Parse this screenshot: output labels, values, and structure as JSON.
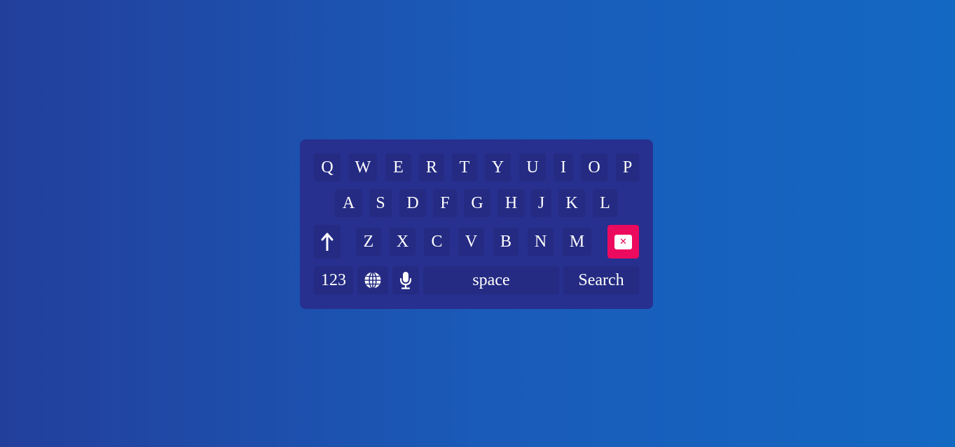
{
  "keyboard": {
    "row1": [
      "Q",
      "W",
      "E",
      "R",
      "T",
      "Y",
      "U",
      "I",
      "O",
      "P"
    ],
    "row2": [
      "A",
      "S",
      "D",
      "F",
      "G",
      "H",
      "J",
      "K",
      "L"
    ],
    "row3": [
      "Z",
      "X",
      "C",
      "V",
      "B",
      "N",
      "M"
    ],
    "numbers_label": "123",
    "space_label": "space",
    "search_label": "Search",
    "shift_icon": "arrow-up-icon",
    "backspace_icon": "backspace-icon",
    "globe_icon": "globe-icon",
    "mic_icon": "microphone-icon"
  },
  "colors": {
    "keyboard_bg": "#272f8f",
    "key_bg": "#252b82",
    "backspace_bg": "#ec0a5e",
    "key_text": "#ffffff"
  }
}
